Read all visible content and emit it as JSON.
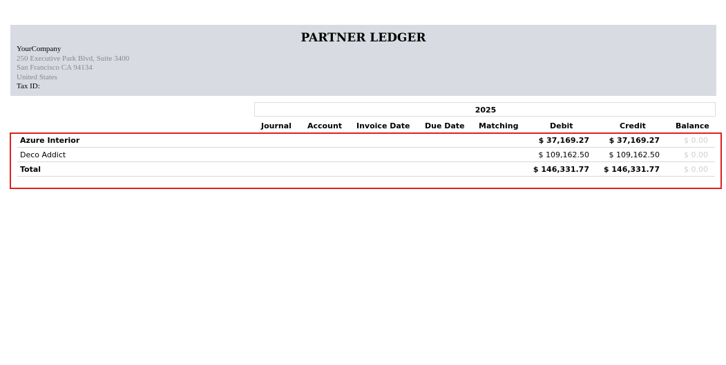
{
  "report": {
    "title": "PARTNER LEDGER",
    "company": {
      "name": "YourCompany",
      "street": "250 Executive Park Blvd, Suite 3400",
      "city": "San Francisco CA 94134",
      "country": "United States",
      "tax_id_label": "Tax ID:"
    },
    "period": "2025",
    "columns": [
      "Journal",
      "Account",
      "Invoice Date",
      "Due Date",
      "Matching",
      "Debit",
      "Credit",
      "Balance"
    ],
    "rows": [
      {
        "name": "Azure Interior",
        "debit": "$ 37,169.27",
        "credit": "$ 37,169.27",
        "balance": "$ 0.00",
        "bold": true
      },
      {
        "name": "Deco Addict",
        "debit": "$ 109,162.50",
        "credit": "$ 109,162.50",
        "balance": "$ 0.00",
        "bold": false
      },
      {
        "name": "Total",
        "debit": "$ 146,331.77",
        "credit": "$ 146,331.77",
        "balance": "$ 0.00",
        "bold": true
      }
    ]
  }
}
